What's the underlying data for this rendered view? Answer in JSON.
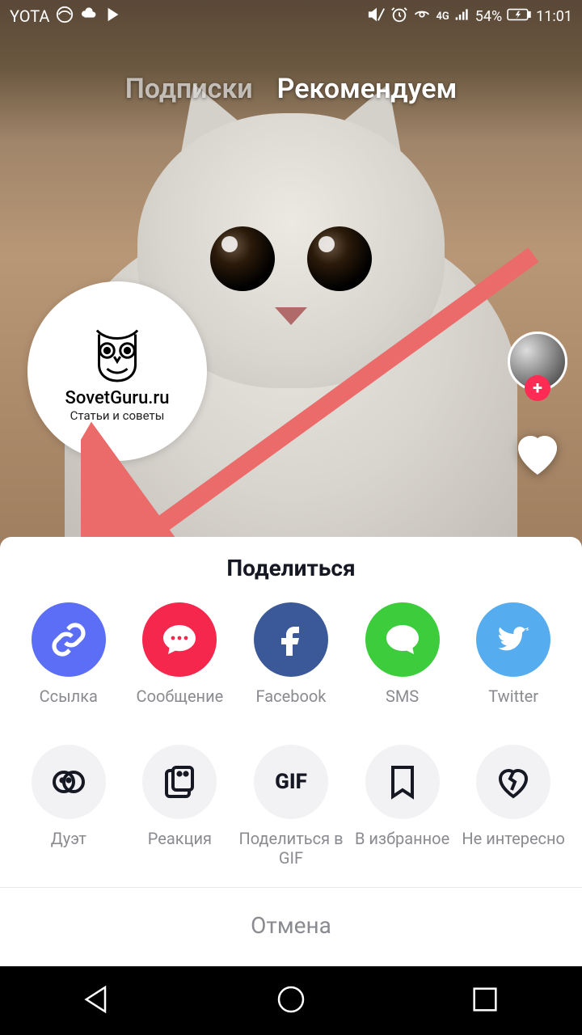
{
  "status": {
    "carrier": "YOTA",
    "signal_label": "4G",
    "battery": "54%",
    "time": "11:01"
  },
  "tabs": {
    "following": "Подписки",
    "for_you": "Рекомендуем"
  },
  "watermark": {
    "title": "SovetGuru.ru",
    "subtitle": "Статьи и советы"
  },
  "share": {
    "title": "Поделиться",
    "cancel": "Отмена",
    "row1": [
      {
        "label": "Ссылка"
      },
      {
        "label": "Сообщение"
      },
      {
        "label": "Facebook"
      },
      {
        "label": "SMS"
      },
      {
        "label": "Twitter"
      }
    ],
    "row2": [
      {
        "label": "Дуэт"
      },
      {
        "label": "Реакция"
      },
      {
        "label": "Поделиться в GIF"
      },
      {
        "label": "В избранное"
      },
      {
        "label": "Не интересно"
      }
    ],
    "gif_text": "GIF"
  },
  "colors": {
    "accent_red": "#fe2c55",
    "link_blue": "#5b6ef5",
    "msg_red": "#f5274d",
    "fb_blue": "#3b5998",
    "sms_green": "#3ccc3c",
    "tw_blue": "#55acee",
    "arrow": "#eb6b6b"
  }
}
